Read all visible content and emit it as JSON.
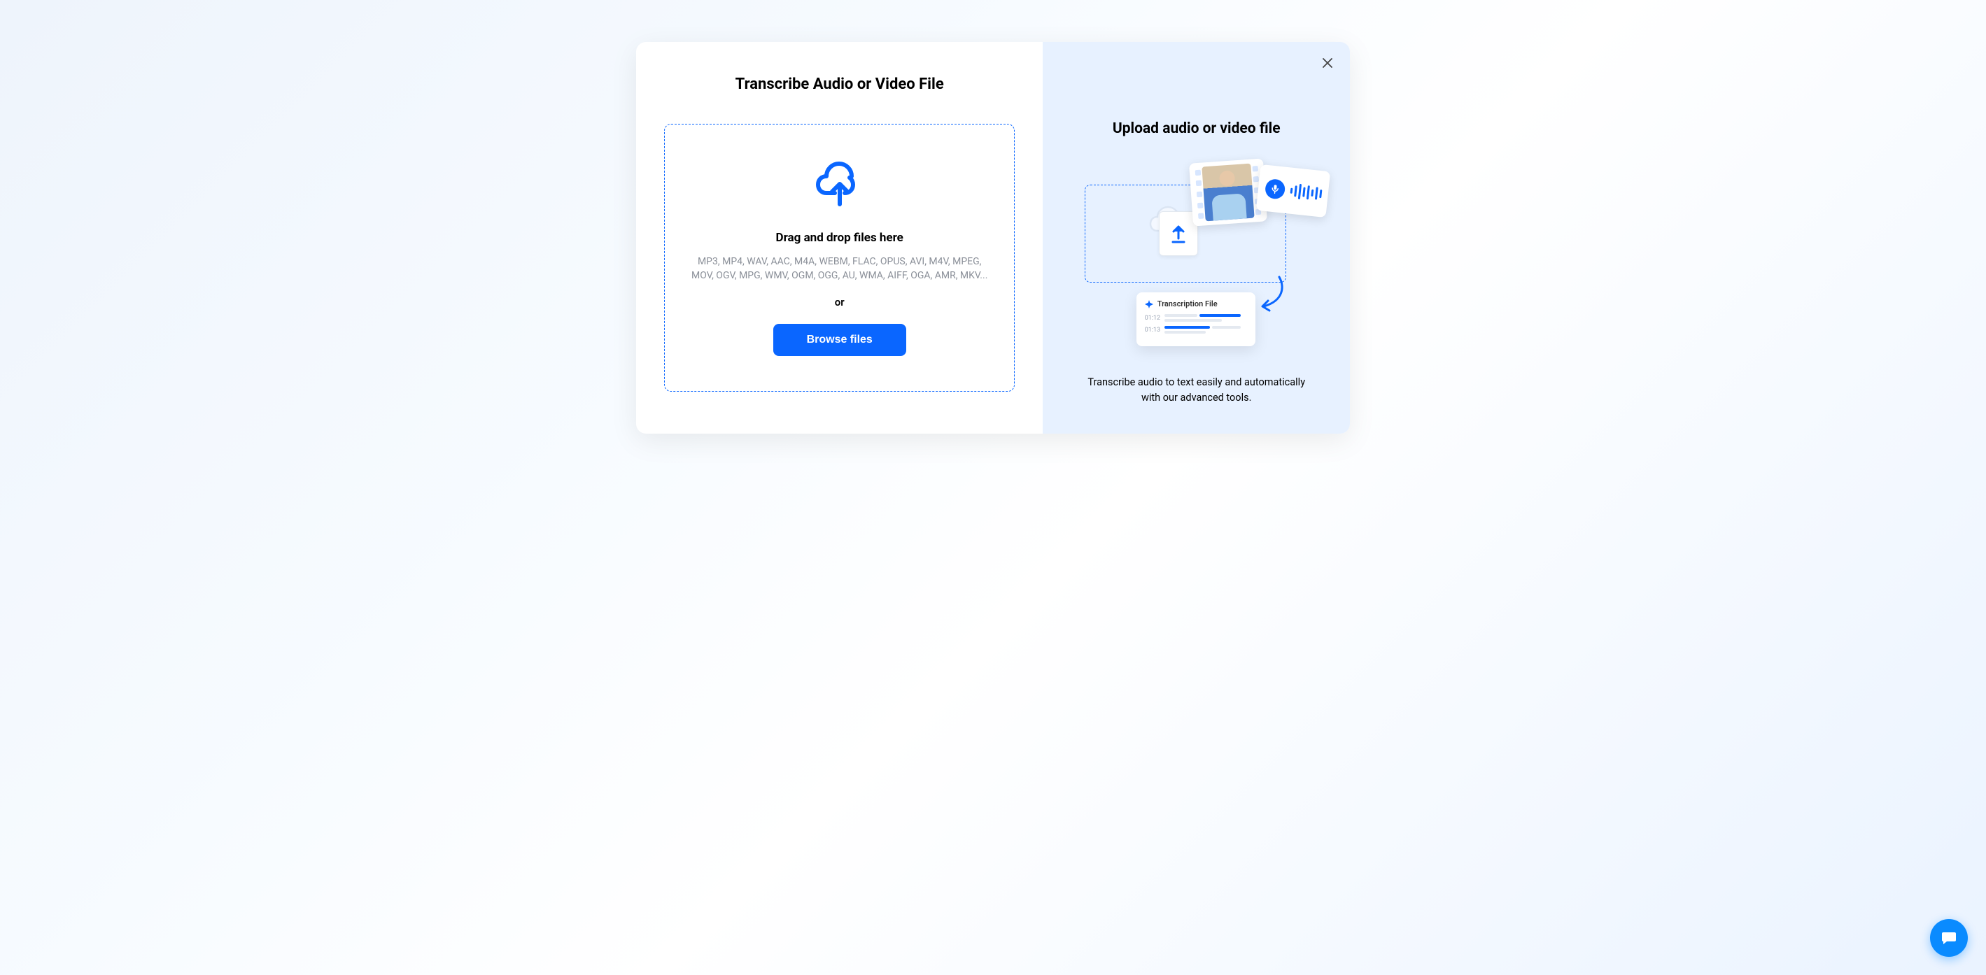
{
  "left": {
    "title": "Transcribe Audio or Video File",
    "drop_title": "Drag and drop files here",
    "formats": "MP3, MP4, WAV, AAC, M4A, WEBM, FLAC, OPUS, AVI, M4V, MPEG, MOV, OGV, MPG, WMV, OGM, OGG, AU, WMA, AIFF, OGA, AMR, MKV...",
    "or": "or",
    "browse_label": "Browse files"
  },
  "right": {
    "title": "Upload audio or video file",
    "description": "Transcribe audio to text easily and automatically with our advanced tools.",
    "card_title": "Transcription File",
    "time1": "01:12",
    "time2": "01:13"
  }
}
